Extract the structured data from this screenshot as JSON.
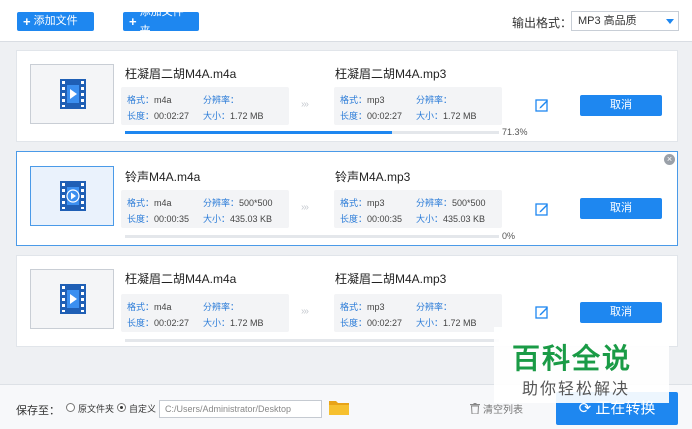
{
  "toolbar": {
    "add_file": "添加文件",
    "add_folder": "添加文件夹",
    "format_label": "输出格式：",
    "format_value": "MP3  高品质"
  },
  "labels": {
    "format": "格式：",
    "resolution": "分辨率：",
    "duration": "长度：",
    "size": "大小：",
    "cancel": "取消"
  },
  "items": [
    {
      "source_name": "枉凝眉二胡M4A.m4a",
      "target_name": "枉凝眉二胡M4A.mp3",
      "source": {
        "format": "m4a",
        "resolution": "",
        "duration": "00:02:27",
        "size": "1.72 MB"
      },
      "target": {
        "format": "mp3",
        "resolution": "",
        "duration": "00:02:27",
        "size": "1.72 MB"
      },
      "progress_text": "71.3%",
      "progress": 0.713,
      "selected": false
    },
    {
      "source_name": "铃声M4A.m4a",
      "target_name": "铃声M4A.mp3",
      "source": {
        "format": "m4a",
        "resolution": "500*500",
        "duration": "00:00:35",
        "size": "435.03 KB"
      },
      "target": {
        "format": "mp3",
        "resolution": "500*500",
        "duration": "00:00:35",
        "size": "435.03 KB"
      },
      "progress_text": "0%",
      "progress": 0,
      "selected": true
    },
    {
      "source_name": "枉凝眉二胡M4A.m4a",
      "target_name": "枉凝眉二胡M4A.mp3",
      "source": {
        "format": "m4a",
        "resolution": "",
        "duration": "00:02:27",
        "size": "1.72 MB"
      },
      "target": {
        "format": "mp3",
        "resolution": "",
        "duration": "00:02:27",
        "size": "1.72 MB"
      },
      "progress_text": "",
      "progress": 0,
      "selected": false
    }
  ],
  "bottom": {
    "save_to": "保存至：",
    "option_original": "原文件夹",
    "option_custom": "自定义",
    "path_value": "C:/Users/Administrator/Desktop",
    "clear_list": "清空列表",
    "convert": "正在转换"
  },
  "watermark": {
    "brand": "百科全说",
    "slogan": "助你轻松解决"
  },
  "colors": {
    "accent": "#1e87f0",
    "brand_green": "#1a9b46"
  }
}
